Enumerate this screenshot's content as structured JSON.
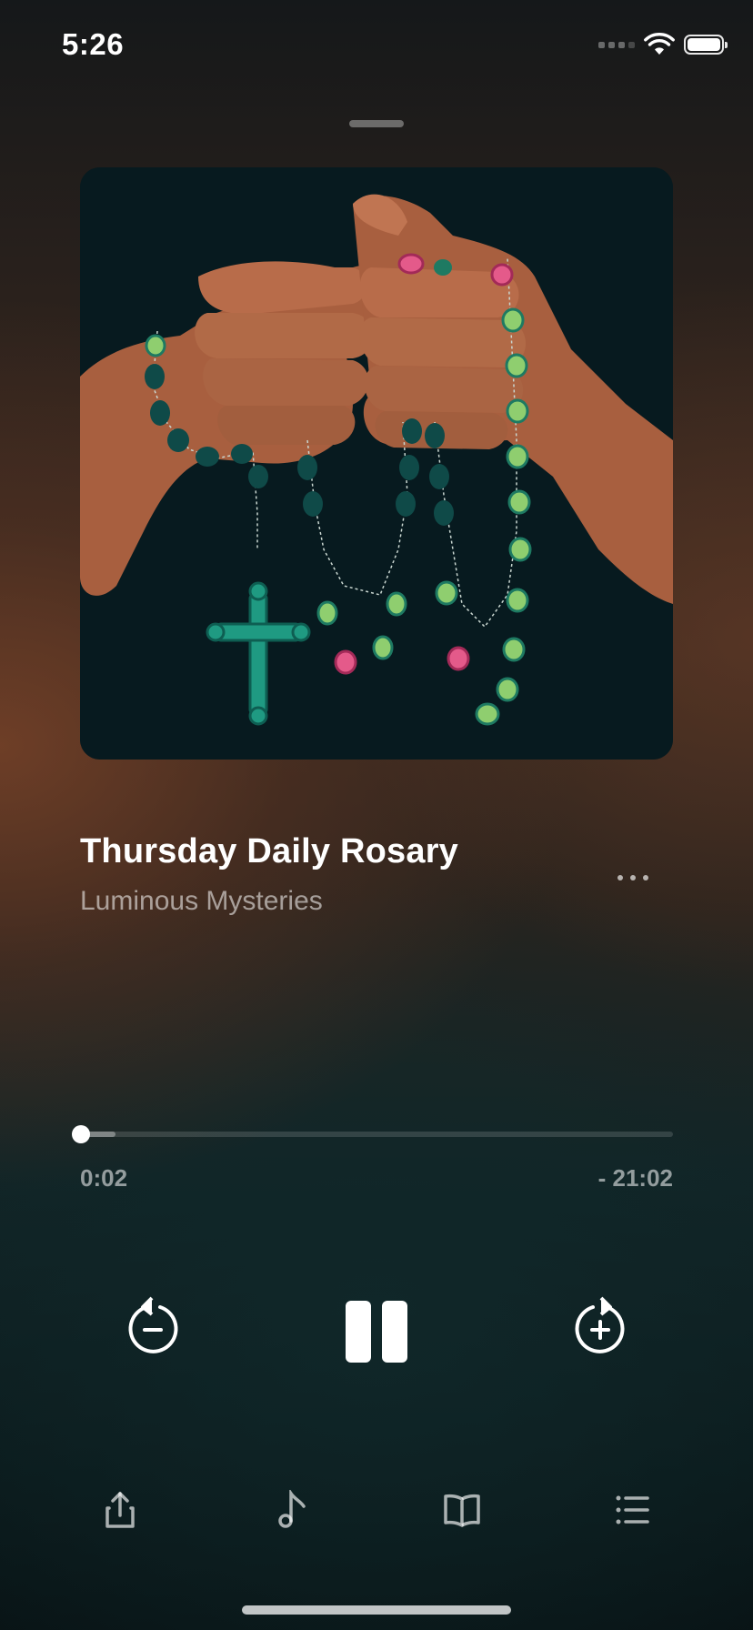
{
  "status_bar": {
    "time": "5:26",
    "icons": [
      "signal-icon",
      "wifi-icon",
      "battery-icon"
    ]
  },
  "episode": {
    "title": "Thursday Daily Rosary",
    "subtitle": "Luminous Mysteries"
  },
  "playback": {
    "elapsed": "0:02",
    "remaining": "- 21:02",
    "progress_fraction": 0.0015,
    "state": "playing"
  },
  "controls": {
    "rewind_icon": "rewind-icon",
    "pause_icon": "pause-icon",
    "forward_icon": "forward-icon"
  },
  "toolbar": {
    "items": [
      "share-icon",
      "music-note-icon",
      "book-icon",
      "list-icon"
    ]
  },
  "colors": {
    "artwork_bg": "#0b1d22",
    "skin": "#b16a47",
    "bead_green": "#8fce6f",
    "bead_pink": "#e45a8a",
    "bead_dark": "#0f4a48",
    "cross": "#1f9a82"
  }
}
